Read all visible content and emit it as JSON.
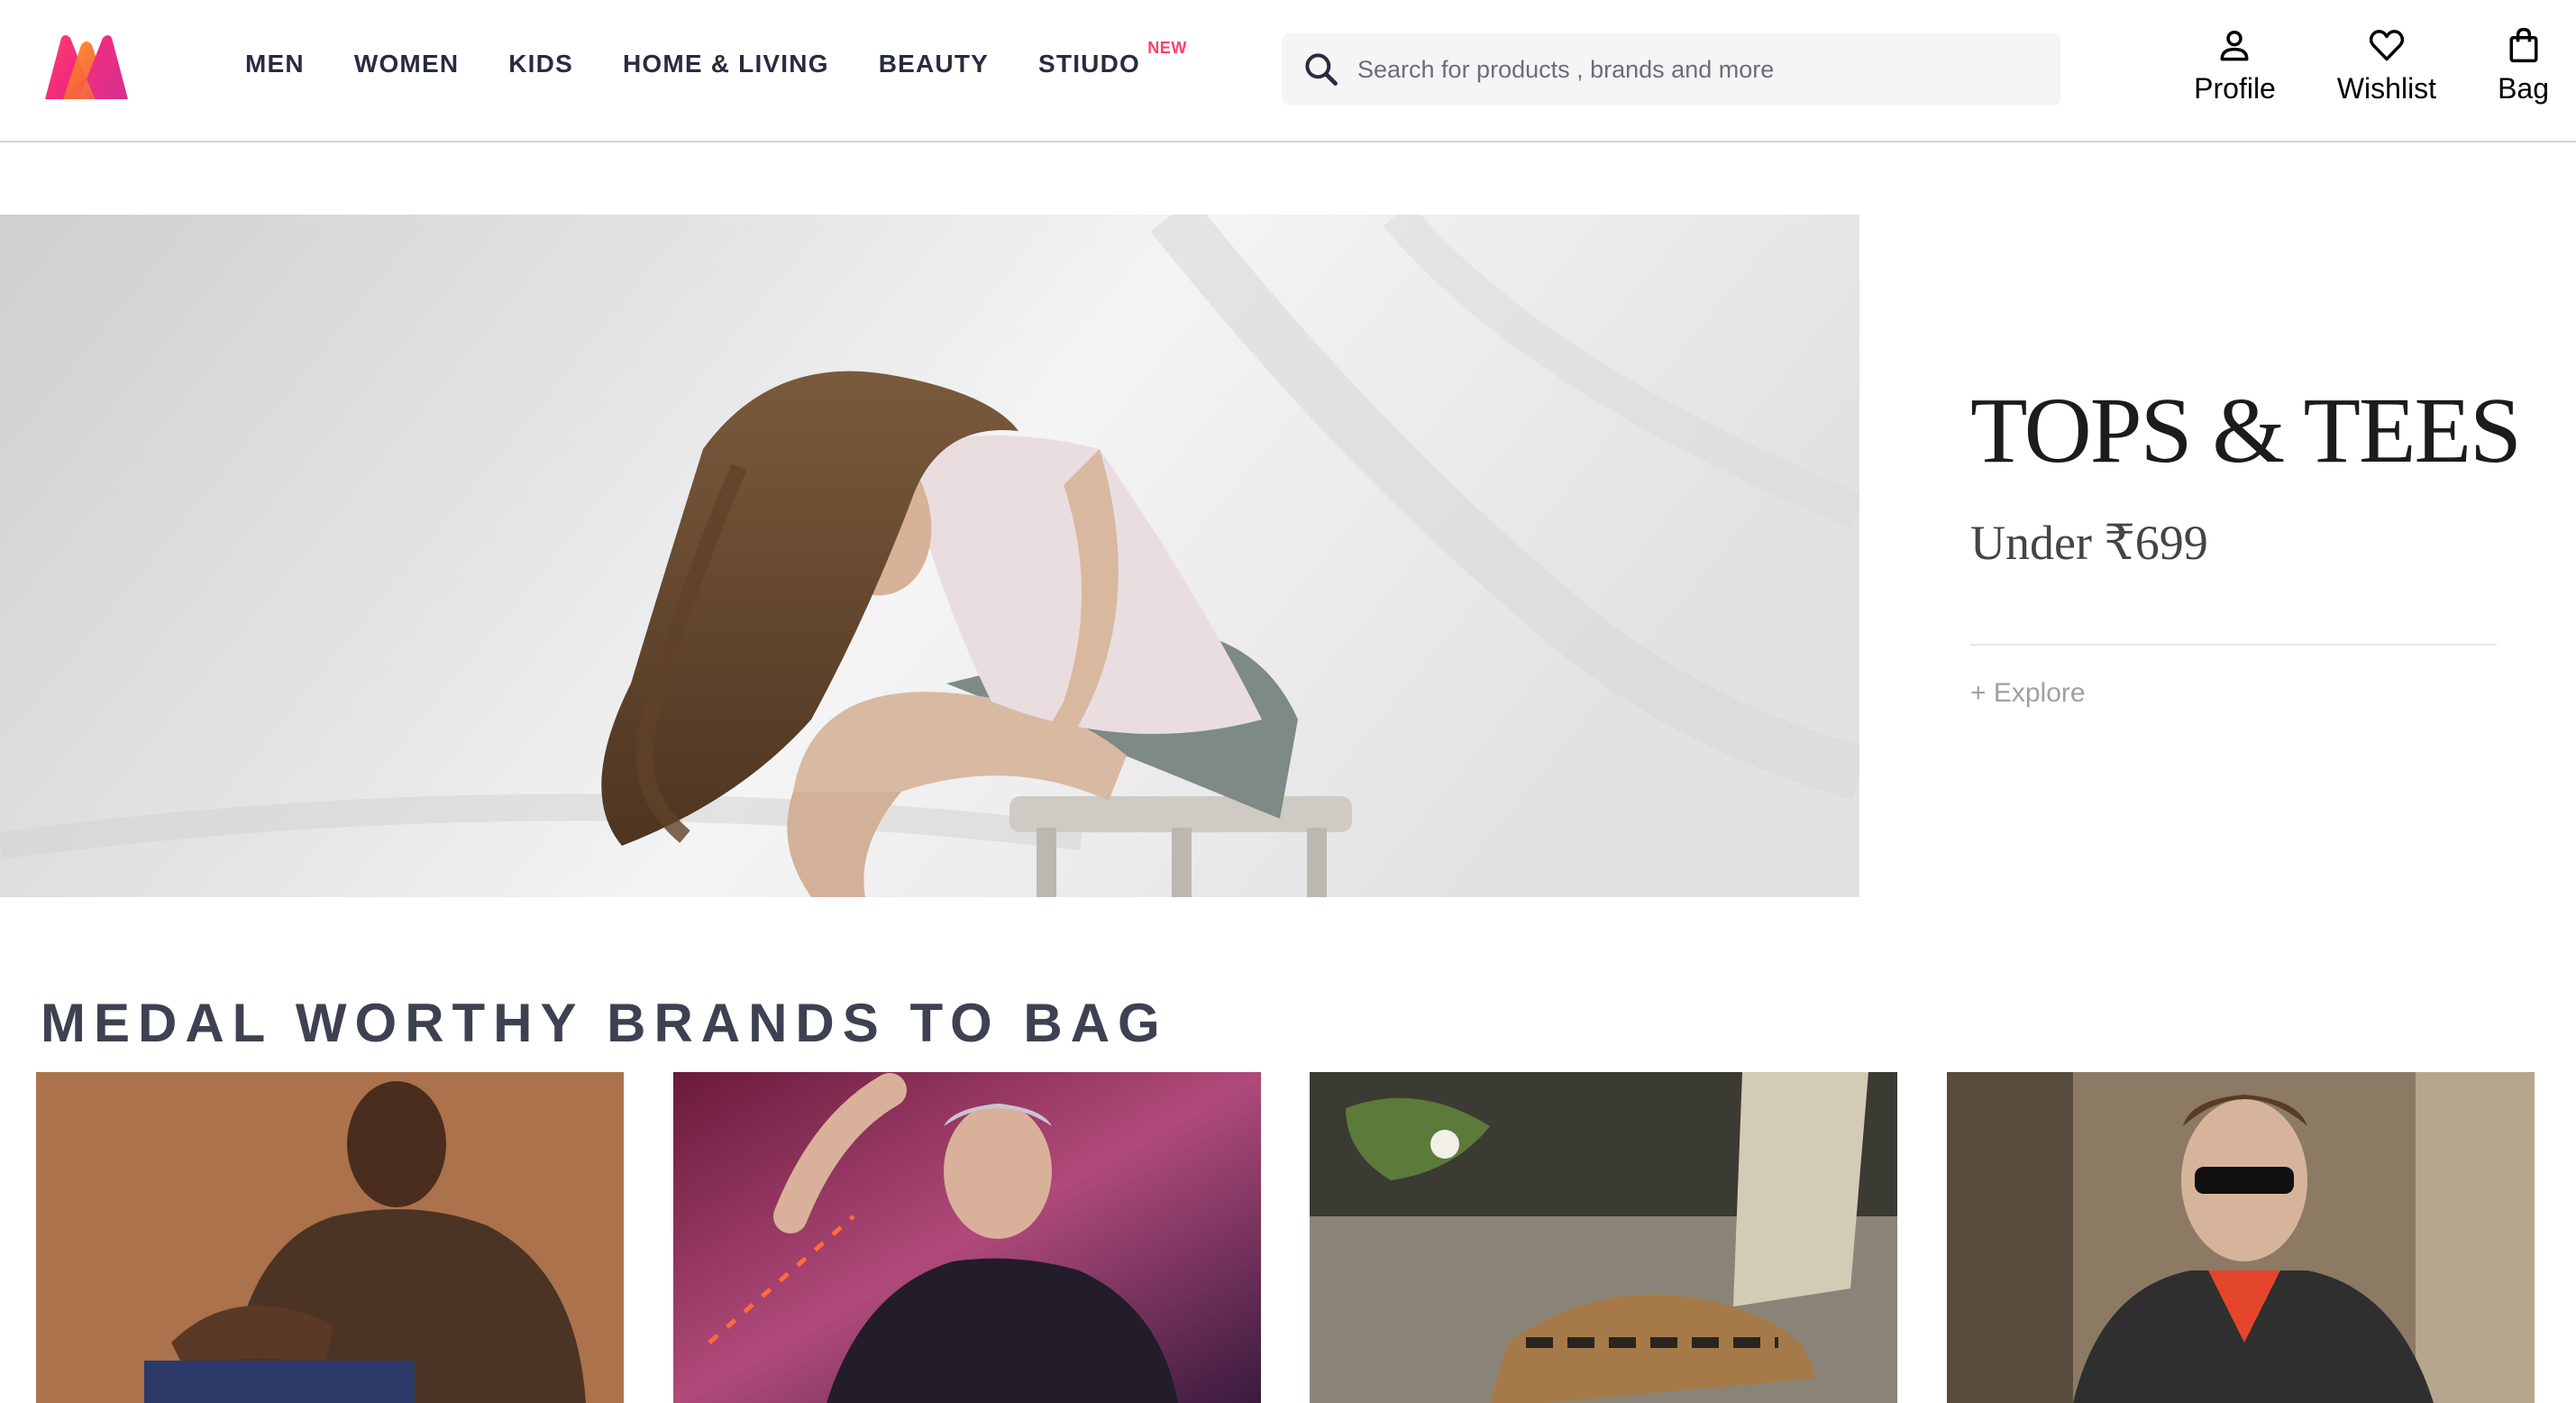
{
  "header": {
    "logo_icon": "myntra-logo-icon",
    "nav": [
      {
        "label": "MEN"
      },
      {
        "label": "WOMEN"
      },
      {
        "label": "KIDS"
      },
      {
        "label": "HOME & LIVING"
      },
      {
        "label": "BEAUTY"
      },
      {
        "label": "STIUDO",
        "badge": "NEW"
      }
    ],
    "search": {
      "icon": "search-icon",
      "placeholder": "Search for products , brands and more",
      "value": ""
    },
    "actions": [
      {
        "label": "Profile",
        "icon": "profile-icon"
      },
      {
        "label": "Wishlist",
        "icon": "heart-icon"
      },
      {
        "label": "Bag",
        "icon": "bag-icon"
      }
    ]
  },
  "hero": {
    "title": "TOPS & TEES",
    "subtitle": "Under ₹699",
    "cta": "+ Explore"
  },
  "brands_section": {
    "title": "MEDAL WORTHY BRANDS TO BAG",
    "cards": [
      {
        "image": "brand-image-man-brown-tee"
      },
      {
        "image": "brand-image-man-printed-tee"
      },
      {
        "image": "brand-image-sneakers"
      },
      {
        "image": "brand-image-man-sunglasses-jacket"
      }
    ]
  },
  "colors": {
    "brand_pink": "#ff3f6c",
    "text_dark": "#282c3f",
    "search_bg": "#f5f5f6"
  }
}
